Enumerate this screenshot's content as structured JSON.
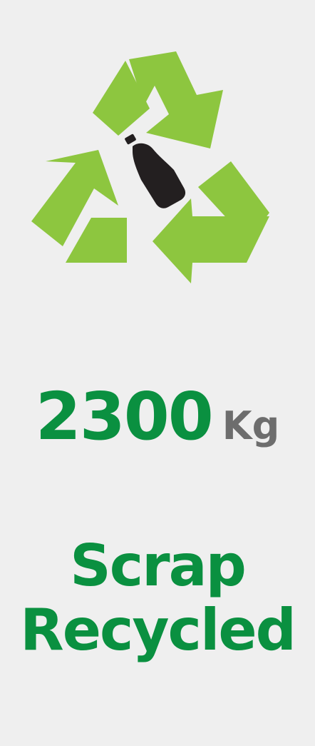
{
  "icon": {
    "name": "recycle-bottle-icon",
    "arrow_color": "#8dc63f",
    "bottle_color": "#231f20"
  },
  "stat": {
    "value": "2300",
    "unit": "Kg",
    "value_color": "#0a9040",
    "unit_color": "#6d6d6d"
  },
  "caption": {
    "line1": "Scrap",
    "line2": "Recycled",
    "color": "#0a9040"
  },
  "background": "#efefef"
}
